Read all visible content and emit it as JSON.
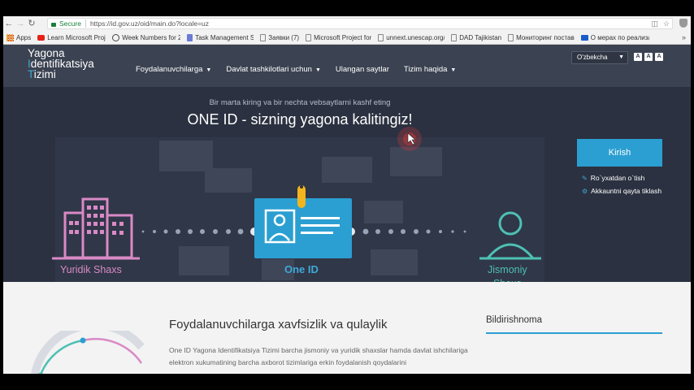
{
  "browser": {
    "back_icon": "back-arrow-icon",
    "forward_icon": "forward-arrow-icon",
    "reload_icon": "reload-icon",
    "secure_label": "Secure",
    "url": "https://id.gov.uz/oid/main.do?locale=uz",
    "bookmarks": [
      {
        "label": "Apps",
        "icon": "apps-grid-icon",
        "color": "#e8a33d"
      },
      {
        "label": "Learn Microsoft Proje",
        "icon": "youtube-icon",
        "color": "#e62117"
      },
      {
        "label": "Week Numbers for 20",
        "icon": "clock-icon",
        "color": "#444444"
      },
      {
        "label": "Task Management Sc",
        "icon": "task-icon",
        "color": "#6b7bd6"
      },
      {
        "label": "Заявки (7)",
        "icon": "page-icon",
        "color": "#888888"
      },
      {
        "label": "Microsoft Project for",
        "icon": "page-icon",
        "color": "#888888"
      },
      {
        "label": "unnext.unescap.org/p",
        "icon": "page-icon",
        "color": "#888888"
      },
      {
        "label": "DAD Tajikistan",
        "icon": "page-icon",
        "color": "#888888"
      },
      {
        "label": "Мониторинг постав",
        "icon": "page-icon",
        "color": "#888888"
      },
      {
        "label": "О мерах по реализа",
        "icon": "flag-icon",
        "color": "#1a5ec9"
      }
    ]
  },
  "site": {
    "logo_line1": "Yagona",
    "logo_line2": "dentifikatsiya",
    "logo_line3": "izimi",
    "logo_initial2": "I",
    "logo_initial3": "T",
    "nav": [
      {
        "label": "Foydalanuvchilarga",
        "has_dropdown": true
      },
      {
        "label": "Davlat tashkilotlari uchun",
        "has_dropdown": true
      },
      {
        "label": "Ulangan saytlar",
        "has_dropdown": false
      },
      {
        "label": "Tizim haqida",
        "has_dropdown": true
      }
    ],
    "language": "O'zbekcha",
    "font_sizes": [
      "A",
      "A",
      "A"
    ]
  },
  "hero": {
    "tagline": "Bir marta kiring va bir nechta vebsaytlarni kashf eting",
    "headline": "ONE ID - sizning yagona kalitingiz!",
    "login_button": "Kirish",
    "register_link": "Ro`yxatdan o`tish",
    "restore_link": "Akkauntni qayta tiklash",
    "legal_entity": "Yuridik Shaxs",
    "one_id": "One ID",
    "individual_line1": "Jismoniy",
    "individual_line2": "Shaxs",
    "colors": {
      "pink": "#d98ac6",
      "blue": "#2b9fd1",
      "teal": "#4ec0b4",
      "yellow": "#f2b51d"
    }
  },
  "content": {
    "section_title": "Foydalanuvchilarga xavfsizlik va qulaylik",
    "section_text": "One ID Yagona Identifikatsiya Tizimi barcha jismoniy va yuridik shaxslar hamda davlat ishchilariga elektron xukumatining barcha axborot tizimlariga erkin foydalanish qoydalarini",
    "notifications_title": "Bildirishnoma"
  }
}
